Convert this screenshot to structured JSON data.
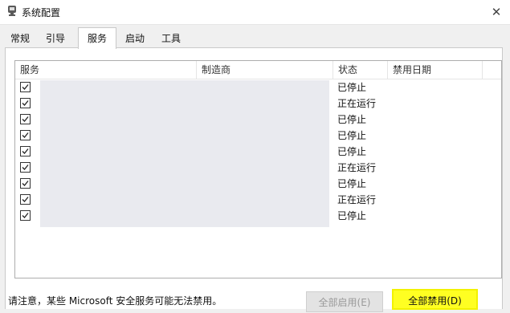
{
  "window": {
    "title": "系统配置",
    "icons": {
      "app": "msconfig-icon",
      "close": "close-icon"
    },
    "close_glyph": "✕"
  },
  "tabs": [
    {
      "label": "常规",
      "active": false
    },
    {
      "label": "引导",
      "active": false
    },
    {
      "label": "服务",
      "active": true
    },
    {
      "label": "启动",
      "active": false
    },
    {
      "label": "工具",
      "active": false
    }
  ],
  "services_table": {
    "columns": [
      "服务",
      "制造商",
      "状态",
      "禁用日期"
    ],
    "rows": [
      {
        "checked": true,
        "status": "已停止"
      },
      {
        "checked": true,
        "status": "正在运行"
      },
      {
        "checked": true,
        "status": "已停止"
      },
      {
        "checked": true,
        "status": "已停止"
      },
      {
        "checked": true,
        "status": "已停止"
      },
      {
        "checked": true,
        "status": "正在运行"
      },
      {
        "checked": true,
        "status": "已停止"
      },
      {
        "checked": true,
        "status": "正在运行"
      },
      {
        "checked": true,
        "status": "已停止"
      }
    ]
  },
  "footer": {
    "note": "请注意，某些 Microsoft 安全服务可能无法禁用。",
    "enable_all_label": "全部启用(E)",
    "disable_all_label": "全部禁用(D)"
  },
  "colors": {
    "highlight": "#ffff22",
    "disabled_text": "#9a9a9a",
    "redaction": "#e9eaef"
  }
}
